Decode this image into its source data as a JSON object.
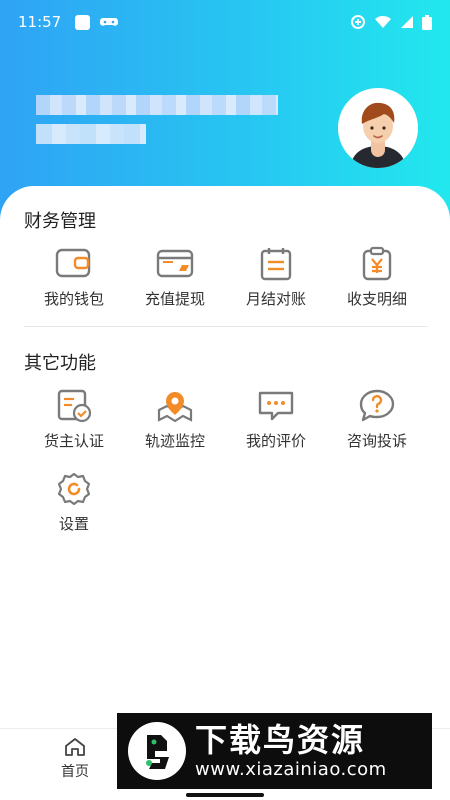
{
  "status_bar": {
    "time": "11:57",
    "left_icons": [
      "square-notification-icon",
      "game-controller-icon"
    ],
    "right_icons": [
      "data-saver-icon",
      "wifi-icon",
      "signal-icon",
      "battery-icon"
    ]
  },
  "profile": {
    "avatar_icon": "cartoon-user-avatar"
  },
  "finance": {
    "title": "财务管理",
    "items": [
      {
        "label": "我的钱包",
        "icon": "wallet-icon"
      },
      {
        "label": "充值提现",
        "icon": "card-recharge-icon"
      },
      {
        "label": "月结对账",
        "icon": "monthly-calendar-icon"
      },
      {
        "label": "收支明细",
        "icon": "yuan-clipboard-icon"
      }
    ]
  },
  "other": {
    "title": "其它功能",
    "items": [
      {
        "label": "货主认证",
        "icon": "certification-icon"
      },
      {
        "label": "轨迹监控",
        "icon": "location-track-icon"
      },
      {
        "label": "我的评价",
        "icon": "comment-bubble-icon"
      },
      {
        "label": "咨询投诉",
        "icon": "question-bubble-icon"
      },
      {
        "label": "设置",
        "icon": "settings-gear-icon"
      }
    ]
  },
  "bottom_nav": {
    "home_label": "首页"
  },
  "watermark": {
    "title": "下载鸟资源",
    "url": "www.xiazainiao.com"
  },
  "colors": {
    "accent_orange": "#f28c28",
    "icon_gray": "#7a7a7a",
    "header_gradient_start": "#2fa3f4",
    "header_gradient_end": "#22e8ee"
  }
}
